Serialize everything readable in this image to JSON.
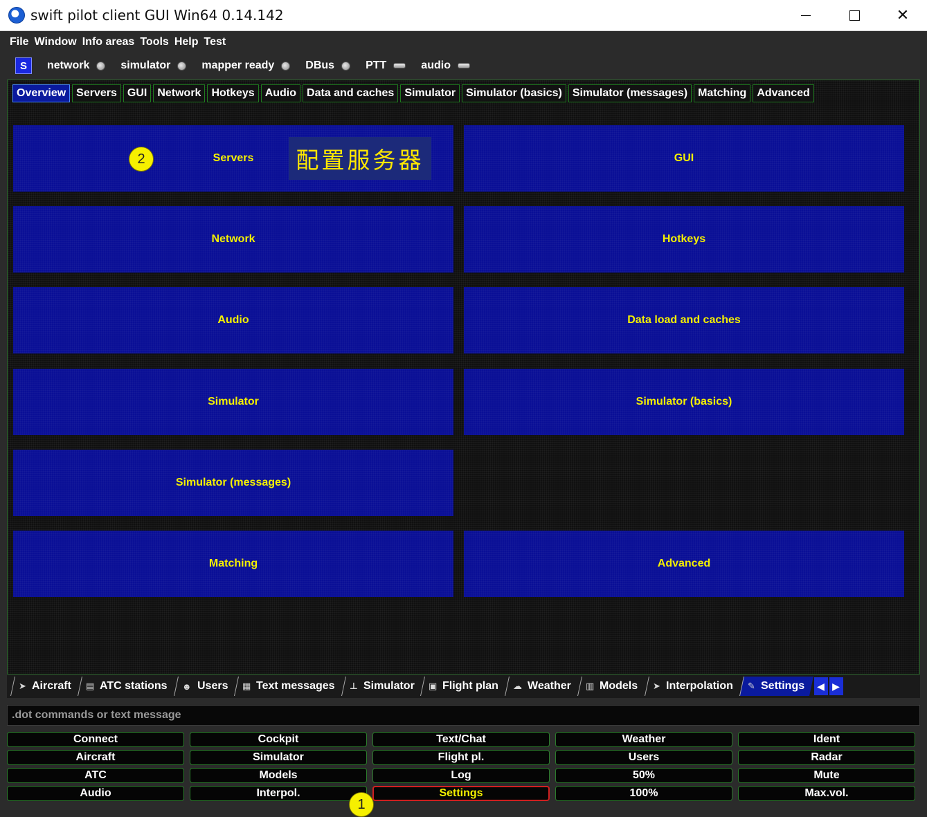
{
  "window": {
    "title": "swift pilot client GUI Win64 0.14.142",
    "controls": [
      "─",
      "☐",
      "✕"
    ]
  },
  "menu": [
    "File",
    "Window",
    "Info areas",
    "Tools",
    "Help",
    "Test"
  ],
  "status": {
    "badge": "S",
    "items": [
      {
        "label": "network",
        "indicator": "led"
      },
      {
        "label": "simulator",
        "indicator": "led"
      },
      {
        "label": "mapper ready",
        "indicator": "led"
      },
      {
        "label": "DBus",
        "indicator": "led"
      },
      {
        "label": "PTT",
        "indicator": "flat"
      },
      {
        "label": "audio",
        "indicator": "flat"
      }
    ]
  },
  "settings_tabs": [
    "Overview",
    "Servers",
    "GUI",
    "Network",
    "Hotkeys",
    "Audio",
    "Data and caches",
    "Simulator",
    "Simulator (basics)",
    "Simulator (messages)",
    "Matching",
    "Advanced"
  ],
  "tiles": [
    "Servers",
    "GUI",
    "Network",
    "Hotkeys",
    "Audio",
    "Data load and caches",
    "Simulator",
    "Simulator (basics)",
    "Simulator (messages)",
    "Matching",
    "Advanced"
  ],
  "annotation": {
    "chinese_label": "配置服务器",
    "callout_1": "1",
    "callout_2": "2"
  },
  "dock_tabs": [
    {
      "label": "Aircraft",
      "icon": "plane-icon"
    },
    {
      "label": "ATC stations",
      "icon": "document-icon"
    },
    {
      "label": "Users",
      "icon": "users-icon"
    },
    {
      "label": "Text messages",
      "icon": "message-icon"
    },
    {
      "label": "Simulator",
      "icon": "joystick-icon"
    },
    {
      "label": "Flight plan",
      "icon": "flightplan-icon"
    },
    {
      "label": "Weather",
      "icon": "weather-icon"
    },
    {
      "label": "Models",
      "icon": "models-icon"
    },
    {
      "label": "Interpolation",
      "icon": "plane-icon"
    },
    {
      "label": "Settings",
      "icon": "wrench-icon"
    }
  ],
  "command": {
    "placeholder": ".dot commands or text message"
  },
  "buttons": [
    "Connect",
    "Cockpit",
    "Text/Chat",
    "Weather",
    "Ident",
    "Aircraft",
    "Simulator",
    "Flight pl.",
    "Users",
    "Radar",
    "ATC",
    "Models",
    "Log",
    "50%",
    "Mute",
    "Audio",
    "Interpol.",
    "Settings",
    "100%",
    "Max.vol."
  ],
  "colors": {
    "tile": "#0a0f96",
    "tile_text": "#f4f000",
    "active_tab": "#0a1a9e",
    "highlight_border": "#d02020"
  }
}
